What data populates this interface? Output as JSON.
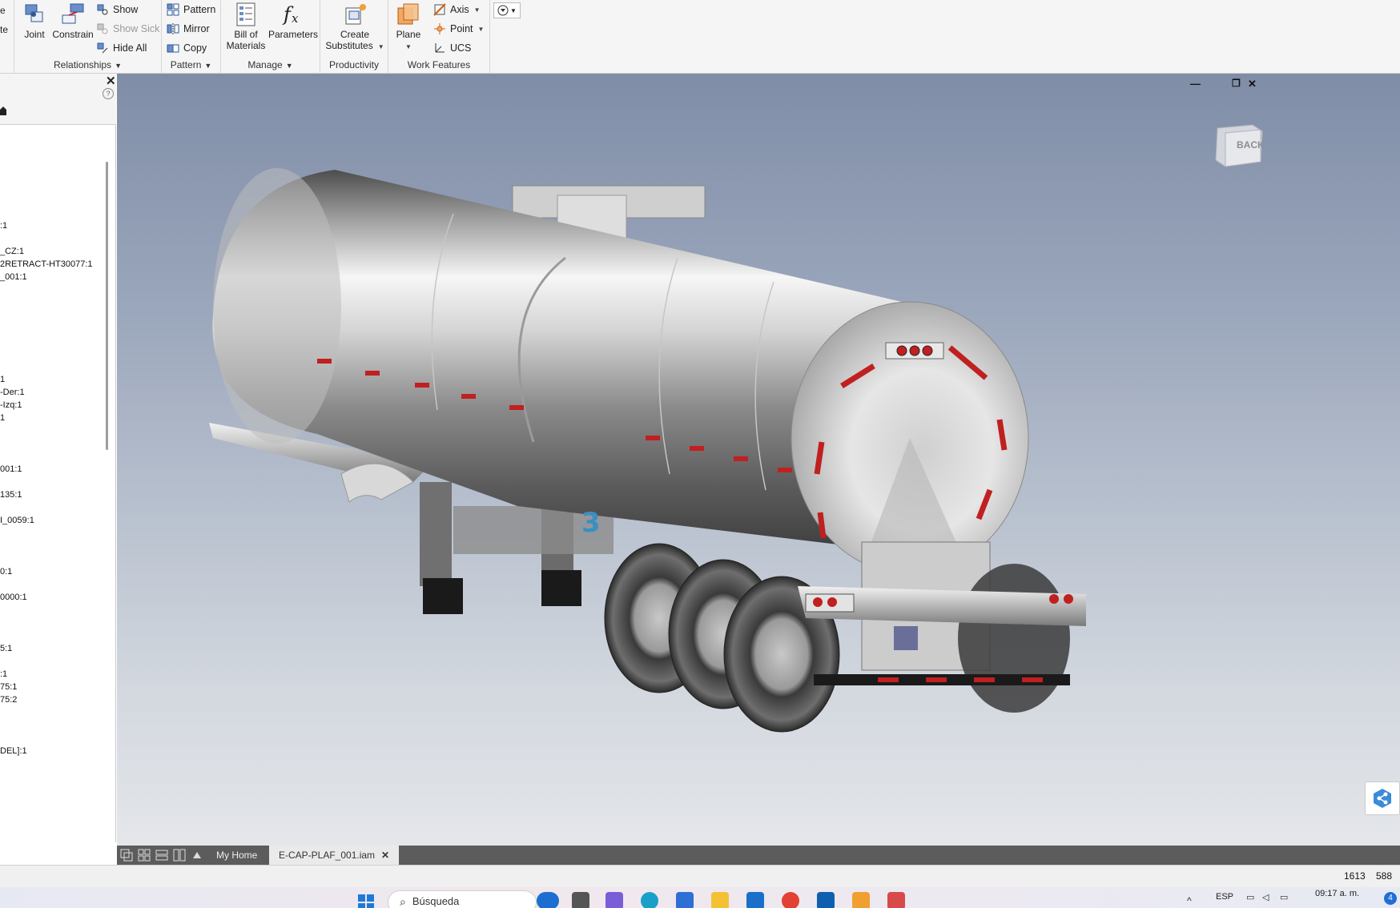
{
  "ribbon": {
    "partial_left_1": "e",
    "partial_left_2": "te",
    "relationships": {
      "joint": "Joint",
      "constrain": "Constrain",
      "show": "Show",
      "show_sick": "Show Sick",
      "hide_all": "Hide All",
      "group_label": "Relationships"
    },
    "pattern": {
      "pattern": "Pattern",
      "mirror": "Mirror",
      "copy": "Copy",
      "group_label": "Pattern"
    },
    "manage": {
      "bom_line1": "Bill of",
      "bom_line2": "Materials",
      "parameters": "Parameters",
      "group_label": "Manage"
    },
    "productivity": {
      "create_line1": "Create",
      "create_line2": "Substitutes",
      "group_label": "Productivity"
    },
    "work_features": {
      "plane": "Plane",
      "axis": "Axis",
      "point": "Point",
      "ucs": "UCS",
      "group_label": "Work Features"
    }
  },
  "browser": {
    "items": [
      ":1",
      "_CZ:1",
      "2RETRACT-HT30077:1",
      "_001:1",
      "1",
      "-Der:1",
      "-Izq:1",
      "1",
      "001:1",
      "135:1",
      "I_0059:1",
      "0:1",
      "0000:1",
      "5:1",
      ":1",
      "75:1",
      "75:2",
      "DEL]:1"
    ]
  },
  "viewcube": {
    "face_label": "BACK"
  },
  "tanker": {
    "number_partial": "3"
  },
  "tabs": {
    "home": "My Home",
    "document": "E-CAP-PLAF_001.iam"
  },
  "status": {
    "value1": "1613",
    "value2": "588"
  },
  "taskbar": {
    "search_placeholder": "Búsqueda",
    "lang": "ESP",
    "time": "09:17 a. m."
  },
  "colors": {
    "ribbon_bg": "#f5f5f5",
    "viewport_top": "#7f8da7",
    "viewport_bottom": "#e4e6ea",
    "tab_bar": "#5c5c5c",
    "reflector_red": "#c02020"
  }
}
